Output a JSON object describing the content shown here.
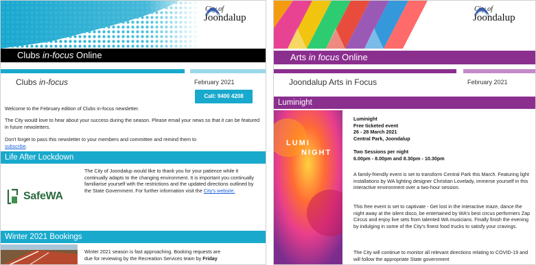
{
  "left": {
    "logo": {
      "line1": "City of",
      "line2": "Joondalup"
    },
    "title_main": "Clubs ",
    "title_em": "in-focus",
    "title_suffix": " Online",
    "subhead_main": "Clubs ",
    "subhead_em": "in-focus",
    "date": "February 2021",
    "call_button": "Call: 9400 4208",
    "welcome": "Welcome to the February edition of Clubs in-focus newsletter.",
    "success_text": "The City would love to hear about your success during the season. Please email your news so that it can be featured in future newsletters.",
    "forward_text": "Don't forget to pass this newsletter to your members and committee and remind them to ",
    "subscribe_link": "subscribe",
    "subscribe_tail": ".",
    "section1_title": "Life After Lockdown",
    "safewa": "SafeWA",
    "lockdown_text": "The City of Joondalup would like to thank you for your patience while it continually adapts to the changing environment. It is important you continually familiarise yourself with the restrictions and the updated directions outlined by the State Government. For further information visit the ",
    "website_link": "City's website.",
    "section2_title": "Winter 2021 Bookings",
    "winter_text_1": "Winter 2021 season is fast approaching. Booking requests are",
    "winter_text_2": "due for reviewing by the Recreation Services team by ",
    "winter_text_bold": "Friday",
    "colors": {
      "accent": "#18a9cc",
      "titlebar": "#000000",
      "section": "#18a9cc"
    }
  },
  "right": {
    "logo": {
      "line1": "City of",
      "line2": "Joondalup"
    },
    "title_main": "Arts ",
    "title_em": "in focus",
    "title_suffix": " Online",
    "subhead": "Joondalup Arts in Focus",
    "date": "February 2021",
    "section_title": "Luminight",
    "lumi_line1": "LUMI",
    "lumi_line2": "NIGHT",
    "event": {
      "name": "Luminight",
      "type": "Free ticketed event",
      "dates": "26 - 28 March 2021",
      "venue": "Central Park, Joondalup",
      "sessions_title": "Two Sessions per night",
      "sessions_times": "6.00pm - 8.00pm and 8.30pm - 10.30pm"
    },
    "para1": "A family-friendly event is set to transform Central Park this March. Featuring light installations by WA lighting designer Christian Lovelady, immerse yourself in this interactive environment over a two-hour session.",
    "para2": "This free event is set to captivate - Get lost in the interactive maze, dance the night away at the silent disco, be entertained by WA's best circus performers Zap Circus and enjoy live sets from talented WA musicians. Finally finish the evening by indulging in some of the City's finest food trucks to satisfy your cravings.",
    "para3": "The City will continue to monitor all relevant directions relating to COVID-19 and will follow the appropriate State government",
    "colors": {
      "accent": "#8b2f8f",
      "section": "#8b2f8f"
    }
  }
}
